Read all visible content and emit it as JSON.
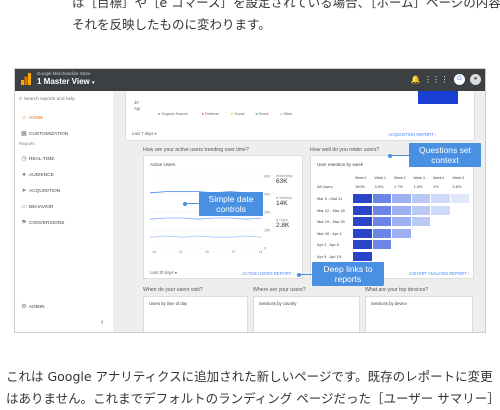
{
  "article": {
    "top_line1": "は［目標］や［e コマース］を設定されている場合、［ホーム］ページの内容は",
    "top_line2": "それを反映したものに変わります。",
    "bottom_line1": "これは Google アナリティクスに追加された新しいページです。既存のレポートに変更",
    "bottom_line2": "はありません。これまでデフォルトのランディング ページだった［ユーザー サマリー］"
  },
  "app": {
    "account": "Google Merchandise Store",
    "view": "1 Master View",
    "search_placeholder": "Search reports and help",
    "reports_header": "Reports",
    "nav": [
      {
        "label": "HOME",
        "icon": "home-icon",
        "glyph": "⌂",
        "active": true
      },
      {
        "label": "CUSTOMIZATION",
        "icon": "grid-icon",
        "glyph": "▦",
        "active": false
      },
      {
        "label": "REAL-TIME",
        "icon": "clock-icon",
        "glyph": "◷",
        "active": false
      },
      {
        "label": "AUDIENCE",
        "icon": "person-icon",
        "glyph": "●",
        "active": false
      },
      {
        "label": "ACQUISITION",
        "icon": "acquisition-icon",
        "glyph": "➤",
        "active": false
      },
      {
        "label": "BEHAVIOR",
        "icon": "behavior-icon",
        "glyph": "▭",
        "active": false
      },
      {
        "label": "CONVERSIONS",
        "icon": "flag-icon",
        "glyph": "⚑",
        "active": false
      }
    ],
    "admin": "ADMIN",
    "collapse": "‹"
  },
  "acq_card": {
    "x_label": "Apr",
    "x_label2": "30",
    "legend": [
      "Organic Search",
      "Referral",
      "Social",
      "Direct",
      "Other"
    ],
    "legend_colors": [
      "#4285f4",
      "#ea4335",
      "#fbbc04",
      "#34a853",
      "#bbbbbb"
    ],
    "date_range": "Last 7 days ▾",
    "report_link": "ACQUISITION REPORT ›"
  },
  "callouts": {
    "simple_date": "Simple date\ncontrols",
    "questions": "Questions set\ncontext",
    "deep_links": "Deep links to\nreports"
  },
  "active_users": {
    "question": "How are your active users trending over time?",
    "title": "Active Users",
    "y_ticks": [
      "60K",
      "45K",
      "30K",
      "15K",
      "0"
    ],
    "x_ticks": [
      "16\nApr",
      "23",
      "30",
      "07\nMay",
      "14"
    ],
    "metrics": [
      {
        "label": "Monthly",
        "value": "63K"
      },
      {
        "label": "Weekly",
        "value": "14K"
      },
      {
        "label": "Daily",
        "value": "2.8K"
      }
    ],
    "series": [
      {
        "name": "Monthly",
        "values": [
          46,
          47,
          47,
          47,
          46,
          47,
          46,
          46
        ]
      },
      {
        "name": "Weekly",
        "values": [
          24,
          25,
          25,
          24,
          25,
          25,
          24,
          25
        ]
      },
      {
        "name": "Daily",
        "values": [
          9,
          10,
          9,
          10,
          9,
          9,
          10,
          9
        ]
      }
    ],
    "date_range": "Last 30 days ▾",
    "report_link": "ACTIVE USERS REPORT ›"
  },
  "retention": {
    "question": "How well do you retain users?",
    "title": "User retention by week",
    "weeks": [
      "Week 0",
      "Week 1",
      "Week 2",
      "Week 3",
      "Week 4",
      "Week 5"
    ],
    "all_users": {
      "label": "All Users",
      "values": [
        "100%",
        "3.3%",
        "1.7%",
        "1.3%",
        "1%",
        "0.6%"
      ]
    },
    "rows": [
      {
        "label": "Mar 5 - Mar 11",
        "cells": 6
      },
      {
        "label": "Mar 12 - Mar 18",
        "cells": 5
      },
      {
        "label": "Mar 19 - Mar 25",
        "cells": 4
      },
      {
        "label": "Mar 26 - Apr 1",
        "cells": 3
      },
      {
        "label": "Apr 2 - Apr 8",
        "cells": 2
      },
      {
        "label": "Apr 9 - Apr 15",
        "cells": 1
      }
    ],
    "report_link": "COHORT ANALYSIS REPORT ›"
  },
  "questions_row": {
    "q1": "When do your users visit?",
    "q2": "Where are your users?",
    "q3": "What are your top devices?",
    "c1": "Users by time of day",
    "c2": "Sessions by country",
    "c3": "Sessions by device"
  }
}
